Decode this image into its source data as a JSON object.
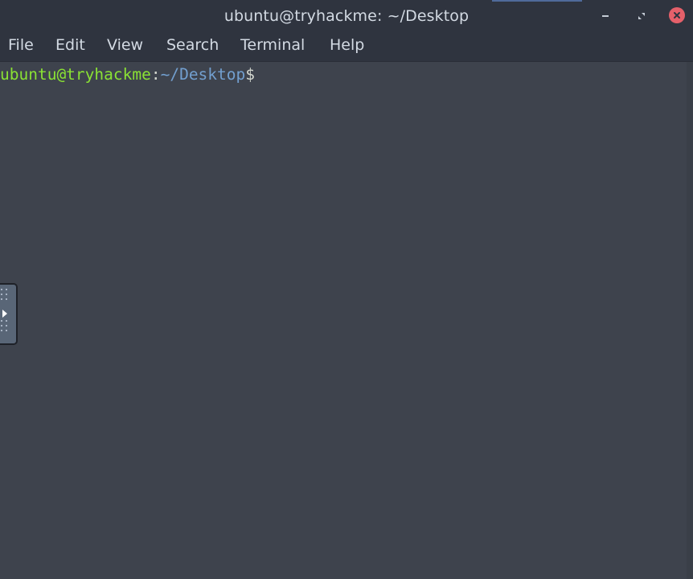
{
  "window": {
    "title": "ubuntu@tryhackme: ~/Desktop",
    "controls": {
      "minimize_icon": "minimize-icon",
      "maximize_icon": "maximize-icon",
      "close_icon": "close-icon"
    }
  },
  "menu": {
    "file": "File",
    "edit": "Edit",
    "view": "View",
    "search": "Search",
    "terminal": "Terminal",
    "help": "Help"
  },
  "terminal": {
    "prompt_user_host": "ubuntu@tryhackme",
    "prompt_separator": ":",
    "prompt_path": "~/Desktop",
    "prompt_symbol": "$",
    "input": ""
  },
  "side_panel": {
    "icon": "expand-arrow-icon"
  },
  "colors": {
    "titlebar_bg": "#2f343f",
    "terminal_bg": "#3e434d",
    "prompt_user": "#8ae234",
    "prompt_path": "#729fcf",
    "close_button": "#e5606a",
    "text": "#d3dae3"
  }
}
